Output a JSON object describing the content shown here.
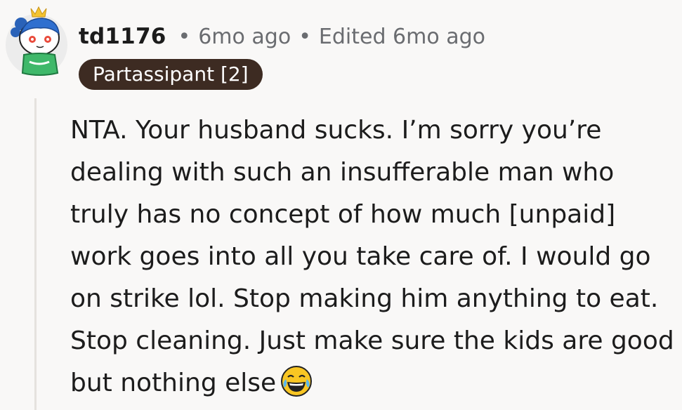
{
  "comment": {
    "author": "td1176",
    "separator": "•",
    "posted": "6mo ago",
    "edited": "Edited 6mo ago",
    "flair": "Partassipant [2]",
    "body": "NTA. Your husband sucks. I’m sorry you’re dealing with such an insufferable man who truly has no concept of how much [unpaid] work goes into all you take care of. I would go on strike lol. Stop making him anything to eat. Stop cleaning. Just make sure the kids are good but nothing else",
    "emoji": "face-with-tears-of-joy-icon"
  },
  "colors": {
    "background": "#f9f8f7",
    "flair_bg": "#3d2b22",
    "meta_text": "#6a6c70",
    "thread_line": "#e5e2de"
  }
}
